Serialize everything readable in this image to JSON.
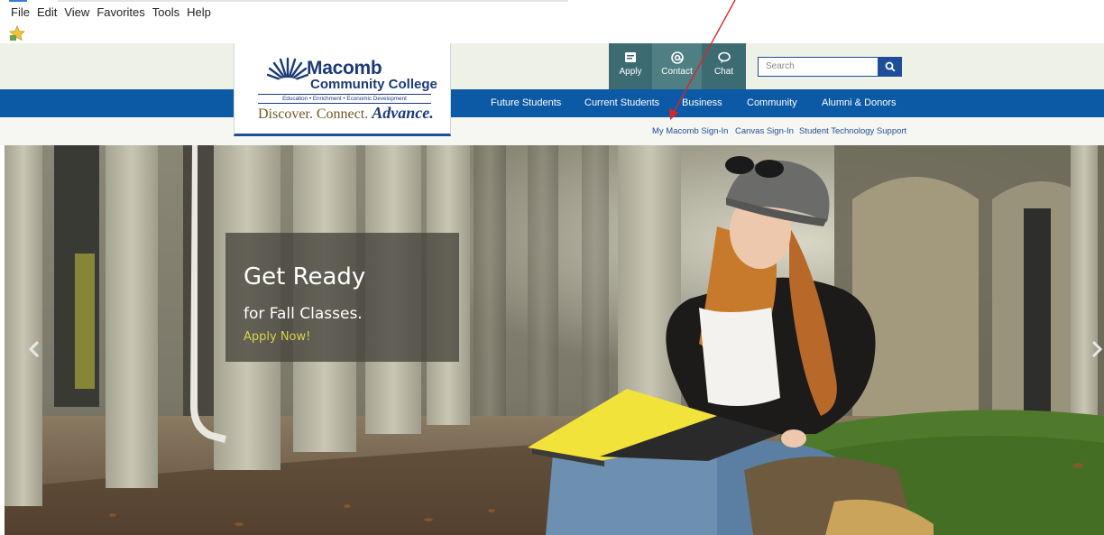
{
  "browser": {
    "menu": [
      "File",
      "Edit",
      "View",
      "Favorites",
      "Tools",
      "Help"
    ]
  },
  "logo": {
    "name_line1": "Macomb",
    "name_line2": "Community College",
    "tagline": "Education • Enrichment • Economic Development",
    "motto": "Discover. Connect.",
    "motto_emphasis": "Advance."
  },
  "utility": {
    "apply": "Apply",
    "contact": "Contact",
    "chat": "Chat"
  },
  "search": {
    "placeholder": "Search"
  },
  "nav": {
    "items": [
      "Future Students",
      "Current Students",
      "Business",
      "Community",
      "Alumni & Donors"
    ]
  },
  "subnav": {
    "items": [
      "My Macomb Sign-In",
      "Canvas Sign-In",
      "Student Technology Support"
    ]
  },
  "hero": {
    "title": "Get Ready",
    "subtitle": "for Fall Classes.",
    "cta": "Apply Now!"
  },
  "colors": {
    "nav_blue": "#0c5aa6",
    "utility_teal": "#3d6b72",
    "cta_yellow": "#d8d34a",
    "annotation_red": "#d62828"
  },
  "icons": {
    "apply": "document-icon",
    "contact": "at-icon",
    "chat": "chat-bubble-icon",
    "search": "magnifier-icon",
    "carousel_prev": "chevron-left-icon",
    "carousel_next": "chevron-right-icon"
  }
}
